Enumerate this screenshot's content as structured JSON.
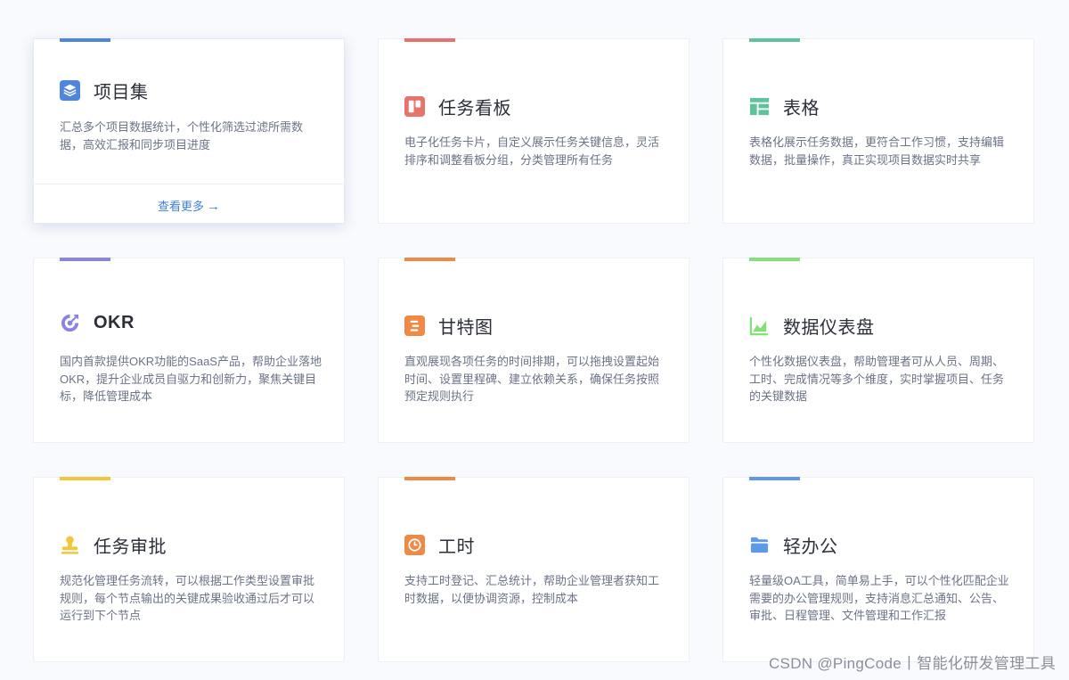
{
  "cards": [
    {
      "title": "项目集",
      "desc": "汇总多个项目数据统计，个性化筛选过滤所需数据，高效汇报和同步项目进度",
      "accent": "#4e86dd",
      "icon": "stack-layers-icon",
      "more": "查看更多"
    },
    {
      "title": "任务看板",
      "desc": "电子化任务卡片，自定义展示任务关键信息，灵活排序和调整看板分组，分类管理所有任务",
      "accent": "#e8726c",
      "icon": "kanban-board-icon"
    },
    {
      "title": "表格",
      "desc": "表格化展示任务数据，更符合工作习惯，支持编辑数据，批量操作，真正实现项目数据实时共享",
      "accent": "#5cc39a",
      "icon": "table-icon"
    },
    {
      "title": "OKR",
      "desc": "国内首款提供OKR功能的SaaS产品，帮助企业落地OKR，提升企业成员自驱力和创新力，聚焦关键目标，降低管理成本",
      "accent": "#8b82e6",
      "icon": "target-icon"
    },
    {
      "title": "甘特图",
      "desc": "直观展现各项任务的时间排期，可以拖拽设置起始时间、设置里程碑、建立依赖关系，确保任务按照预定规则执行",
      "accent": "#ee8a45",
      "icon": "gantt-icon"
    },
    {
      "title": "数据仪表盘",
      "desc": "个性化数据仪表盘，帮助管理者可从人员、周期、工时、完成情况等多个维度，实时掌握项目、任务的关键数据",
      "accent": "#86e07a",
      "icon": "area-chart-icon"
    },
    {
      "title": "任务审批",
      "desc": "规范化管理任务流转，可以根据工作类型设置审批规则，每个节点输出的关键成果验收通过后才可以运行到下个节点",
      "accent": "#f2c63d",
      "icon": "approval-stamp-icon"
    },
    {
      "title": "工时",
      "desc": "支持工时登记、汇总统计，帮助企业管理者获知工时数据，以便协调资源，控制成本",
      "accent": "#ee8a45",
      "icon": "clock-icon"
    },
    {
      "title": "轻办公",
      "desc": "轻量级OA工具，简单易上手，可以个性化匹配企业需要的办公管理规则，支持消息汇总通知、公告、审批、日程管理、文件管理和工作汇报",
      "accent": "#5e9ae8",
      "icon": "folder-icon"
    }
  ],
  "watermark": "CSDN @PingCode丨智能化研发管理工具"
}
